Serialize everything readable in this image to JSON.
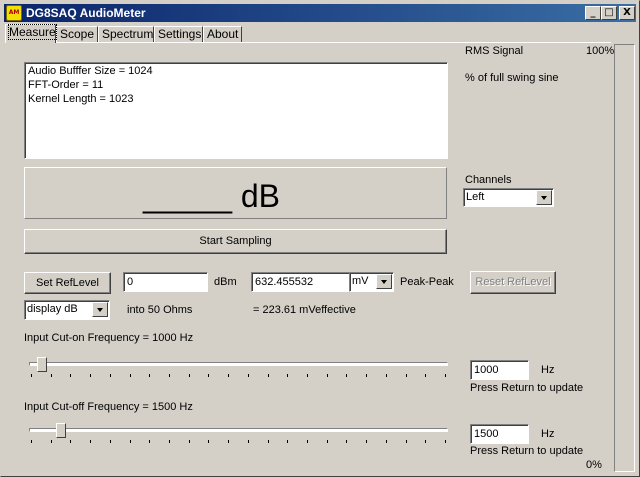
{
  "window": {
    "title": "DG8SAQ AudioMeter",
    "app_icon_text": "AM",
    "minimize_glyph": "_",
    "maximize_glyph": "□",
    "close_glyph": "X",
    "titlebar_color": "#0a246a"
  },
  "tabs": [
    {
      "label": "Measure",
      "active": true
    },
    {
      "label": "Scope",
      "active": false
    },
    {
      "label": "Spectrum",
      "active": false
    },
    {
      "label": "Settings",
      "active": false
    },
    {
      "label": "About",
      "active": false
    }
  ],
  "info": {
    "lines": [
      "Audio Bufffer Size = 1024",
      "FFT-Order = 11",
      "Kernel Length = 1023"
    ]
  },
  "reading": {
    "value": "_____",
    "unit": "dB"
  },
  "start_button": "Start Sampling",
  "rms": {
    "label": "RMS Signal",
    "top_percent": "100%",
    "caption": "% of full swing sine",
    "bottom_percent": "0%",
    "level": 0
  },
  "channels": {
    "label": "Channels",
    "selected": "Left"
  },
  "ref": {
    "set_button": "Set RefLevel",
    "dbm_value": "0",
    "dbm_unit": "dBm",
    "mv_value": "632.455532",
    "mv_unit_selected": "mV",
    "peak_label": "Peak-Peak",
    "reset_button": "Reset RefLevel",
    "display_selected": "display dB",
    "ohms_text": "into 50 Ohms",
    "effective_text": "= 223.61 mVeffective"
  },
  "cut_on": {
    "label": "Input Cut-on Frequency = 1000 Hz",
    "value": "1000",
    "unit": "Hz",
    "hint": "Press Return to update",
    "slider_fraction": 0.02
  },
  "cut_off": {
    "label": "Input Cut-off Frequency = 1500 Hz",
    "value": "1500",
    "unit": "Hz",
    "hint": "Press Return to update",
    "slider_fraction": 0.065
  }
}
